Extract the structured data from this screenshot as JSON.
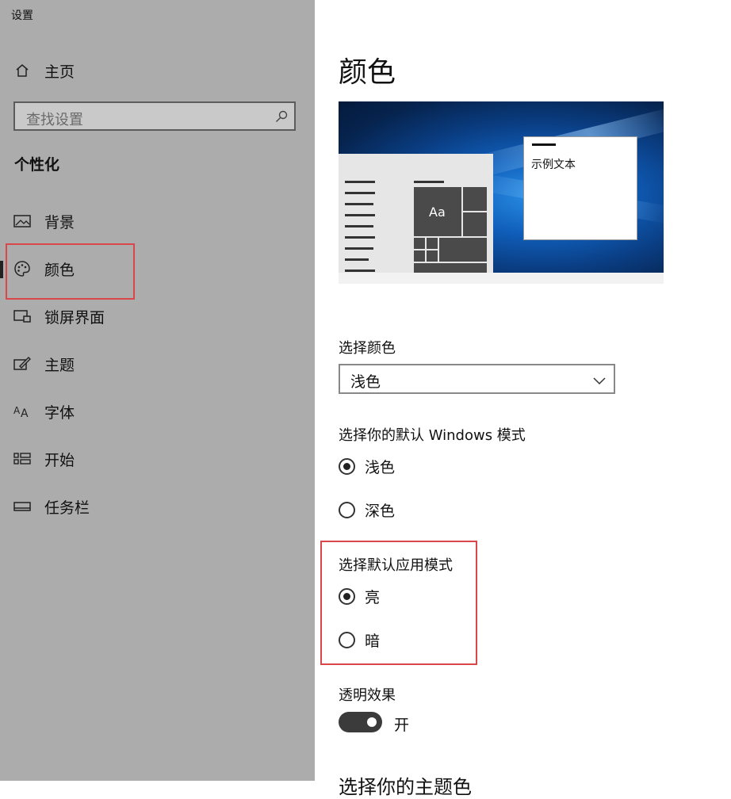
{
  "app": {
    "title": "设置"
  },
  "sidebar": {
    "home": {
      "label": "主页",
      "icon": "home-icon"
    },
    "search": {
      "placeholder": "查找设置",
      "icon": "search-icon"
    },
    "section_title": "个性化",
    "items": [
      {
        "label": "背景",
        "icon": "image-icon",
        "selected": false
      },
      {
        "label": "颜色",
        "icon": "palette-icon",
        "selected": true
      },
      {
        "label": "锁屏界面",
        "icon": "lock-screen-icon",
        "selected": false
      },
      {
        "label": "主题",
        "icon": "brush-icon",
        "selected": false
      },
      {
        "label": "字体",
        "icon": "font-icon",
        "selected": false
      },
      {
        "label": "开始",
        "icon": "start-icon",
        "selected": false
      },
      {
        "label": "任务栏",
        "icon": "taskbar-icon",
        "selected": false
      }
    ]
  },
  "main": {
    "title": "颜色",
    "preview": {
      "tile_text": "Aa",
      "sample_text": "示例文本"
    },
    "choose_color": {
      "label": "选择颜色",
      "value": "浅色"
    },
    "windows_mode": {
      "label": "选择你的默认 Windows 模式",
      "options": [
        {
          "label": "浅色",
          "checked": true
        },
        {
          "label": "深色",
          "checked": false
        }
      ]
    },
    "app_mode": {
      "label": "选择默认应用模式",
      "options": [
        {
          "label": "亮",
          "checked": true
        },
        {
          "label": "暗",
          "checked": false
        }
      ]
    },
    "transparency": {
      "label": "透明效果",
      "state": "开",
      "on": true
    },
    "next_heading": "选择你的主题色"
  },
  "colors": {
    "sidebar_bg": "#acacac",
    "highlight_box": "#d9474b",
    "accent_blue": "#0f5db8"
  }
}
